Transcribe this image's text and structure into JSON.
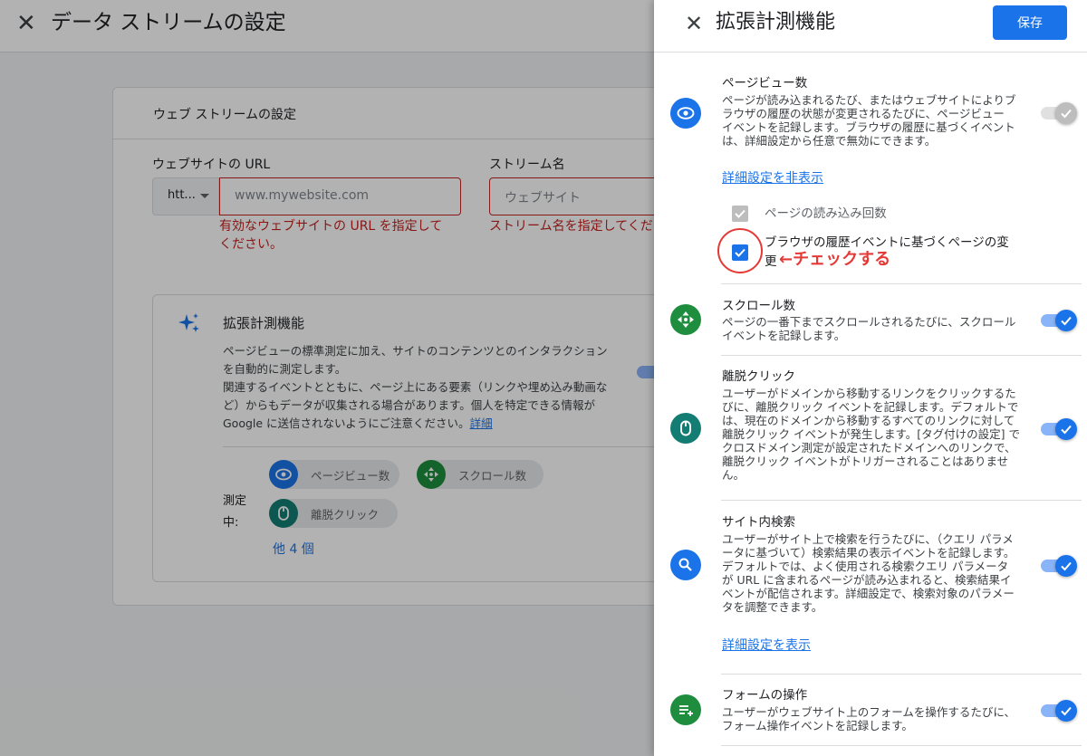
{
  "background": {
    "title": "データ ストリームの設定",
    "card_title": "ウェブ ストリームの設定",
    "url_label": "ウェブサイトの URL",
    "stream_label": "ストリーム名",
    "protocol_value": "htt...",
    "url_placeholder": "www.mywebsite.com",
    "stream_placeholder": "ウェブサイト",
    "url_error_line1": "有効なウェブサイトの URL を指定して",
    "url_error_line2": "ください。",
    "stream_error": "ストリーム名を指定してくだ",
    "em_title": "拡張計測機能",
    "em_desc_1": "ページビューの標準測定に加え、サイトのコンテンツとのインタラクション",
    "em_desc_2": "を自動的に測定します。",
    "em_desc_3": "関連するイベントとともに、ページ上にある要素（リンクや埋め込み動画な",
    "em_desc_4": "ど）からもデータが収集される場合があります。個人を特定できる情報が",
    "em_desc_5": "Google に送信されないようにご注意ください。",
    "em_link": "詳細",
    "measuring_line1": "測定",
    "measuring_line2": "中:",
    "chips": [
      "ページビュー数",
      "スクロール数",
      "離脱クリック"
    ],
    "more_label": "他 4 個"
  },
  "panel": {
    "title": "拡張計測機能",
    "save_label": "保存",
    "annotation": "←チェックする",
    "sections": {
      "pageview": {
        "title": "ページビュー数",
        "desc": [
          "ページが読み込まれるたび、またはウェブサイトによりブ",
          "ラウザの履歴の状態が変更されるたびに、ページビュー",
          "イベントを記録します。ブラウザの履歴に基づくイベント",
          "は、詳細設定から任意で無効にできます。"
        ],
        "link": "詳細設定を非表示",
        "cb1_label": "ページの読み込み回数",
        "cb2_label_1": "ブラウザの履歴イベントに基づくページの変",
        "cb2_label_2": "更"
      },
      "scroll": {
        "title": "スクロール数",
        "desc": [
          "ページの一番下までスクロールされるたびに、スクロール",
          "イベントを記録します。"
        ]
      },
      "outbound": {
        "title": "離脱クリック",
        "desc": [
          "ユーザーがドメインから移動するリンクをクリックするた",
          "びに、離脱クリック イベントを記録します。デフォルトで",
          "は、現在のドメインから移動するすべてのリンクに対して",
          "離脱クリック イベントが発生します。[タグ付けの設定] で",
          "クロスドメイン測定が設定されたドメインへのリンクで、",
          "離脱クリック イベントがトリガーされることはありませ",
          "ん。"
        ]
      },
      "search": {
        "title": "サイト内検索",
        "desc": [
          "ユーザーがサイト上で検索を行うたびに、（クエリ パラメ",
          "ータに基づいて）検索結果の表示イベントを記録します。",
          "デフォルトでは、よく使用される検索クエリ パラメータ",
          "が URL に含まれるページが読み込まれると、検索結果イ",
          "ベントが配信されます。詳細設定で、検索対象のパラメー",
          "タを調整できます。"
        ],
        "link": "詳細設定を表示"
      },
      "form": {
        "title": "フォームの操作",
        "desc": [
          "ユーザーがウェブサイト上のフォームを操作するたびに、",
          "フォーム操作イベントを記録します。"
        ]
      }
    }
  },
  "colors": {
    "primary": "#1a73e8",
    "green": "#1e8e3e",
    "teal": "#137d74",
    "error": "#c5221f",
    "annotation": "#e53935"
  }
}
